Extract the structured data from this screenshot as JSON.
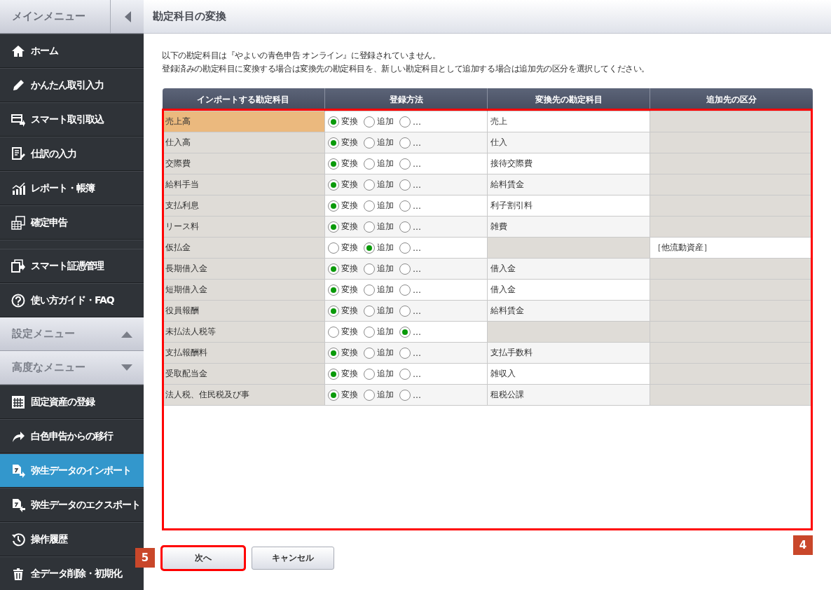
{
  "sidebar": {
    "title": "メインメニュー",
    "main_items": [
      {
        "label": "ホーム",
        "selected": false
      },
      {
        "label": "かんたん取引入力",
        "selected": false
      },
      {
        "label": "スマート取引取込",
        "selected": false
      },
      {
        "label": "仕訳の入力",
        "selected": false
      },
      {
        "label": "レポート・帳簿",
        "selected": false
      },
      {
        "label": "確定申告",
        "selected": false
      }
    ],
    "support_items": [
      {
        "label": "スマート証憑管理",
        "selected": false
      },
      {
        "label": "使い方ガイド・FAQ",
        "selected": false
      }
    ],
    "sections": [
      {
        "title": "設定メニュー",
        "expanded": true
      },
      {
        "title": "高度なメニュー",
        "expanded": false,
        "items": [
          {
            "label": "固定資産の登録",
            "selected": false
          },
          {
            "label": "白色申告からの移行",
            "selected": false
          },
          {
            "label": "弥生データのインポート",
            "selected": true
          },
          {
            "label": "弥生データのエクスポート",
            "selected": false
          },
          {
            "label": "操作履歴",
            "selected": false
          },
          {
            "label": "全データ削除・初期化",
            "selected": false
          }
        ]
      }
    ]
  },
  "page": {
    "title": "勘定科目の変換",
    "intro": [
      "以下の勘定科目は『やよいの青色申告 オンライン』に登録されていません。",
      "登録済みの勘定科目に変換する場合は変換先の勘定科目を、新しい勘定科目として追加する場合は追加先の区分を選択してください。"
    ],
    "table": {
      "callout": "4",
      "columns": [
        "インポートする勘定科目",
        "登録方法",
        "変換先の勘定科目",
        "追加先の区分"
      ],
      "rows": [
        {
          "account": "売上高",
          "selected": true,
          "options": [
            {
              "label": "変換",
              "selected": true
            },
            {
              "label": "追加",
              "selected": false
            },
            {
              "label": "…",
              "selected": false
            }
          ],
          "target": "売上"
        },
        {
          "account": "仕入高",
          "selected": false,
          "options": [
            {
              "label": "変換",
              "selected": true
            },
            {
              "label": "追加",
              "selected": false
            },
            {
              "label": "…",
              "selected": false
            }
          ],
          "target": "仕入"
        },
        {
          "account": "交際費",
          "selected": false,
          "options": [
            {
              "label": "変換",
              "selected": true
            },
            {
              "label": "追加",
              "selected": false
            },
            {
              "label": "…",
              "selected": false
            }
          ],
          "target": "接待交際費"
        },
        {
          "account": "給料手当",
          "selected": false,
          "options": [
            {
              "label": "変換",
              "selected": true
            },
            {
              "label": "追加",
              "selected": false
            },
            {
              "label": "…",
              "selected": false
            }
          ],
          "target": "給料賃金"
        },
        {
          "account": "支払利息",
          "selected": false,
          "options": [
            {
              "label": "変換",
              "selected": true
            },
            {
              "label": "追加",
              "selected": false
            },
            {
              "label": "…",
              "selected": false
            }
          ],
          "target": "利子割引料"
        },
        {
          "account": "リース料",
          "selected": false,
          "options": [
            {
              "label": "変換",
              "selected": true
            },
            {
              "label": "追加",
              "selected": false
            },
            {
              "label": "…",
              "selected": false
            }
          ],
          "target": "雑費"
        },
        {
          "account": "仮払金",
          "selected": false,
          "options": [
            {
              "label": "変換",
              "selected": false
            },
            {
              "label": "追加",
              "selected": true
            },
            {
              "label": "…",
              "selected": false
            }
          ],
          "category": "［他流動資産］"
        },
        {
          "account": "長期借入金",
          "selected": false,
          "options": [
            {
              "label": "変換",
              "selected": true
            },
            {
              "label": "追加",
              "selected": false
            },
            {
              "label": "…",
              "selected": false
            }
          ],
          "target": "借入金"
        },
        {
          "account": "短期借入金",
          "selected": false,
          "options": [
            {
              "label": "変換",
              "selected": true
            },
            {
              "label": "追加",
              "selected": false
            },
            {
              "label": "…",
              "selected": false
            }
          ],
          "target": "借入金"
        },
        {
          "account": "役員報酬",
          "selected": false,
          "options": [
            {
              "label": "変換",
              "selected": true
            },
            {
              "label": "追加",
              "selected": false
            },
            {
              "label": "…",
              "selected": false
            }
          ],
          "target": "給料賃金"
        },
        {
          "account": "未払法人税等",
          "selected": false,
          "options": [
            {
              "label": "変換",
              "selected": false
            },
            {
              "label": "追加",
              "selected": false
            },
            {
              "label": "…",
              "selected": true
            }
          ]
        },
        {
          "account": "支払報酬料",
          "selected": false,
          "options": [
            {
              "label": "変換",
              "selected": true
            },
            {
              "label": "追加",
              "selected": false
            },
            {
              "label": "…",
              "selected": false
            }
          ],
          "target": "支払手数料"
        },
        {
          "account": "受取配当金",
          "selected": false,
          "options": [
            {
              "label": "変換",
              "selected": true
            },
            {
              "label": "追加",
              "selected": false
            },
            {
              "label": "…",
              "selected": false
            }
          ],
          "target": "雑収入"
        },
        {
          "account": "法人税、住民税及び事",
          "selected": false,
          "options": [
            {
              "label": "変換",
              "selected": true
            },
            {
              "label": "追加",
              "selected": false
            },
            {
              "label": "…",
              "selected": false
            }
          ],
          "target": "租税公課"
        }
      ]
    },
    "buttons": [
      {
        "label": "次へ",
        "callout": "5"
      },
      {
        "label": "キャンセル"
      }
    ]
  }
}
